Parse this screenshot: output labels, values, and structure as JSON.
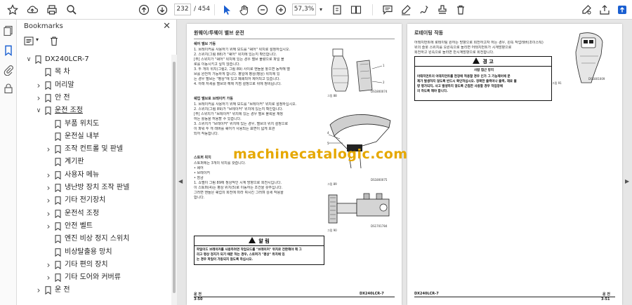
{
  "toolbar": {
    "page_current": "232",
    "page_total": "/ 454",
    "zoom": "57,3%"
  },
  "bookmarks": {
    "title": "Bookmarks",
    "items": [
      {
        "label": "DX240LCR-7",
        "level": 0,
        "expander": "open"
      },
      {
        "label": "목 차",
        "level": 1,
        "expander": "none"
      },
      {
        "label": "머리말",
        "level": 1,
        "expander": "closed"
      },
      {
        "label": "안 전",
        "level": 1,
        "expander": "closed"
      },
      {
        "label": "운전 조정",
        "level": 1,
        "expander": "open"
      },
      {
        "label": "부품 위치도",
        "level": 2,
        "expander": "none"
      },
      {
        "label": "운전실 내부",
        "level": 2,
        "expander": "none"
      },
      {
        "label": "조작 컨트롤 및 판넬",
        "level": 2,
        "expander": "closed"
      },
      {
        "label": "계기판",
        "level": 2,
        "expander": "none"
      },
      {
        "label": "사용자 메뉴",
        "level": 2,
        "expander": "closed"
      },
      {
        "label": "냉난방 장치 조작 판넬",
        "level": 2,
        "expander": "closed"
      },
      {
        "label": "기타 전기장치",
        "level": 2,
        "expander": "closed"
      },
      {
        "label": "운전석 조정",
        "level": 2,
        "expander": "closed"
      },
      {
        "label": "안전 벨트",
        "level": 2,
        "expander": "closed"
      },
      {
        "label": "엔진 비상 정지 스위치",
        "level": 2,
        "expander": "none"
      },
      {
        "label": "비상탈출용 망치",
        "level": 2,
        "expander": "none"
      },
      {
        "label": "기타 편의 장치",
        "level": 2,
        "expander": "closed"
      },
      {
        "label": "기타 도어와 커버류",
        "level": 2,
        "expander": "closed"
      },
      {
        "label": "운 전",
        "level": 1,
        "expander": "closed"
      }
    ]
  },
  "left_page": {
    "title": "원웨이/투웨이 밸브 운전",
    "sec1_title": "쉐어 밸브 가동",
    "sec1_lines": [
      "1.    브레이커를 사용하기 위해 모드를 \"쉐어\" 위치로 설정하십시오.",
      "2.    스위치(그림 88)가 \"쉐어\" 위치에 있는지 확인합니다.",
      "[주]  스위치가 \"쉐어\" 위치에 있는 경우 밸브 불량으로 파일 블",
      "       로를 이동시키고 싶지 않습니다.",
      "3.    두 개의 위치(그림2, 그림 89) 사이로 핸들을 놓으면 동작해 밸",
      "       브를 완전히 가능하게 합니다. 평일에 평상(평상) 위치에 있",
      "       는 경우 밸브는 \"평상\"에 있고 폐쇄되어 제어되고 있습니다.",
      "4.    아래 자세를 밸브와 해제 지점 설정으로 위에 정비됩니다."
    ],
    "sec2_title": "쉐업 밸브로 브레이커 가동",
    "sec2_lines": [
      "1.    브레이커를 사용하기 위해 모드를 \"브레이커\" 위치로 설정하십시오.",
      "2.    스위치(그림 89)가 \"브레이커\" 위치에 있는지 확인합니다.",
      "[주]  스위치가 \"브레이커\" 위치에 있는 경우 밸브 블록을 재정",
      "       하는 활동을 허용할 수 있습니다.",
      "3.    스위치가 \"브레이커\" 위치에 있는 경우, 밸브의 위치 설정으로",
      "       이 파워 두 개 레버를 쉐어가 사용되는 표면이 넓게 보관",
      "       되어 작동합니다."
    ],
    "sec3_title": "스토퍼 위치",
    "sec3_lines": [
      "스토퍼에는 3개의 위치를 갖습니다.",
      "•      쉐어",
      "•      브레이커",
      "•      잠금",
      "1.    쇼벨이 그림 89에 정상적인 시계 방향으로 회전시킵니다.",
      "       이 스토퍼(4)는 평상 위치(5)로 이동하는 조건을 갖추십니다.",
      "       그러면 핸들은 쉐업의 회전에 따라 휘시킨 그러며 상세 작용을",
      "       합니다."
    ],
    "fig88_label": "그림 88",
    "fig88_code": "DS1800074",
    "fig89_label": "그림 89",
    "fig89_code": "DS1800075",
    "fig90_label": "그림 90",
    "fig90_code": "DS1701784",
    "notice_title": "알 림",
    "notice_lines": [
      "파일이드 브레이커를 사용하려면 작업모드를 \"브레이커\" 위치로 전환해야 해 그",
      "리고 평상 정지가 되기 때문 하는 경우, 스토퍼가 \"평상\" 위치에 있",
      "는 경우 파일이 가동되지 않도록 하십시오."
    ],
    "footer_left": "운 전",
    "footer_left_num": "3-50",
    "footer_right": "DX240LCR-7"
  },
  "right_page": {
    "title": "로테이팅 작동",
    "intro_lines": [
      "어태치먼트에 로테이팅 원하는 방향으로 회전하고자 하는 경우, 왼쪽 작업레버(조이스틱)",
      "위의 슬롯 스위치를 오른쪽으로 돌리면 어태치먼트가 시계방향으로",
      "회전하고 왼쪽으로 돌리면 반시계방향으로 회전합니다."
    ],
    "warning_title": "경 고",
    "warning_sub": "사람 접근 방지",
    "warning_lines": [
      "어태치먼트의 어태치먼트를 현장에 적용할 경우 인가 그 기능제어에 문",
      "제가 발생하지 않도록 반드시 확인하십시오. 정확한 출력이나 출력, 재료 불",
      "량 평가되지, 사고 발생하지 않도록 근접한 사용할 경우 작업장에",
      "의 하도록 해야 합니다."
    ],
    "fig91_label": "그림 91",
    "fig91_code": "DS1801009",
    "footer_left": "DX240LCR-7",
    "footer_right": "운 전",
    "footer_right_num": "3-51"
  },
  "watermark": "machinecatalogic.com"
}
